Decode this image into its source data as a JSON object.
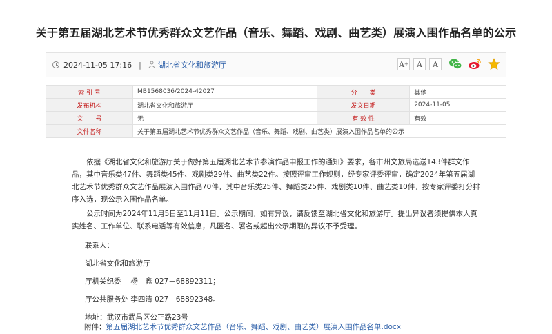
{
  "title": "关于第五届湖北艺术节优秀群众文艺作品（音乐、舞蹈、戏剧、曲艺类）展演入围作品名单的公示",
  "meta": {
    "date": "2024-11-05 17:16",
    "separator": "|",
    "source": "湖北省文化和旅游厅"
  },
  "tools": {
    "font_large": "A",
    "font_medium": "A",
    "font_small": "A"
  },
  "info_table": {
    "rows": [
      {
        "k1": "索 引 号",
        "v1": "MB1568036/2024-42027",
        "k2": "分　　类",
        "v2": "其他"
      },
      {
        "k1": "发布机构",
        "v1": "湖北省文化和旅游厅",
        "k2": "发文日期",
        "v2": "2024-11-05"
      },
      {
        "k1": "文　　号",
        "v1": "无",
        "k2": "有 效 性",
        "v2": "有效"
      }
    ],
    "filename_label": "文件名称",
    "filename_value": "关于第五届湖北艺术节优秀群众文艺作品（音乐、舞蹈、戏剧、曲艺类）展演入围作品名单的公示"
  },
  "body": {
    "p1": "依据《湖北省文化和旅游厅关于做好第五届湖北艺术节参演作品申报工作的通知》要求，各市州文旅局选送143件群文作品，其中音乐类47件、舞蹈类45件、戏剧类29件、曲艺类22件。按照评审工作规则，经专家评委评审，确定2024年第五届湖北艺术节优秀群众文艺作品展演入围作品70件，其中音乐类25件、舞蹈类25件、戏剧类10件、曲艺类10件，按专家评委打分排序入选，现公示入围作品名单。",
    "p2": "公示时间为2024年11月5日至11月11日。公示期间，如有异议，请反馈至湖北省文化和旅游厅。提出异议者须提供本人真实姓名、工作单位、联系电话等有效信息，凡匿名、署名或超出公示期限的异议不予受理。",
    "contact_label": "联系人：",
    "org": "湖北省文化和旅游厅",
    "contact1": "厅机关纪委　 杨　鑫  027－68892311；",
    "contact2": "厅公共服务处  李四清  027－68892348。",
    "address": "地址：武汉市武昌区公正路23号"
  },
  "attachment": {
    "label": "附件：",
    "link": "第五届湖北艺术节优秀群众文艺作品（音乐、舞蹈、戏剧、曲艺类）展演入围作品名单.docx"
  },
  "colors": {
    "table_key": "#c41a1a",
    "link": "#2b5ea8",
    "wechat": "#43b549",
    "weibo": "#e6162d",
    "favorite": "#f5b800"
  }
}
